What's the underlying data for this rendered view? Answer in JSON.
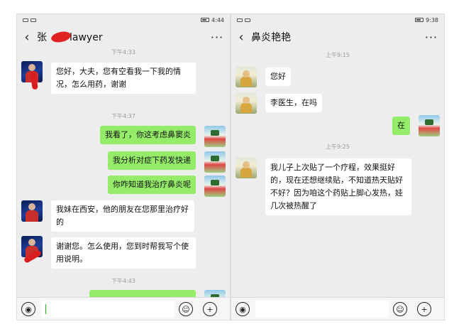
{
  "left_phone": {
    "status": {
      "time": "4:44"
    },
    "title": {
      "prefix": "张",
      "name": "平lawyer"
    },
    "timestamps": [
      "下午4:33",
      "下午4:37",
      "下午4:43"
    ],
    "messages": [
      {
        "side": "in",
        "text": "您好，大夫，您有空看我一下我的情况，怎么用药，谢谢"
      },
      {
        "side": "out",
        "text": "我看了，你这考虑鼻窦炎"
      },
      {
        "side": "out",
        "text": "我分析对症下药发快递"
      },
      {
        "side": "out",
        "text": "你咋知道我治疗鼻炎呢"
      },
      {
        "side": "in",
        "text": "我妹在西安，他的朋友在您那里治疗好的"
      },
      {
        "side": "in",
        "text": "谢谢您。怎么使用，您到时帮我写个使用说明。"
      }
    ],
    "input": {
      "value": ""
    }
  },
  "right_phone": {
    "status": {
      "time": "9:38"
    },
    "title": {
      "name": "鼻炎艳艳"
    },
    "timestamps": [
      "上午9:15",
      "上午9:25"
    ],
    "messages": [
      {
        "side": "in",
        "text": "您好"
      },
      {
        "side": "in",
        "text": "李医生，在吗"
      },
      {
        "side": "out",
        "text": "在"
      },
      {
        "side": "in",
        "text": "我儿子上次贴了一个疗程，效果挺好的，现在还想继续贴，不知道热天贴好不好？因为咱这个药贴上脚心发热，娃几次被热醒了"
      }
    ],
    "input": {
      "value": ""
    }
  },
  "icons": {
    "back": "‹",
    "more": "···",
    "voice": "◉",
    "emoji": "☺",
    "add": "+"
  },
  "colors": {
    "out_bubble": "#95ec69",
    "in_bubble": "#ffffff",
    "chat_bg": "#ededed"
  }
}
